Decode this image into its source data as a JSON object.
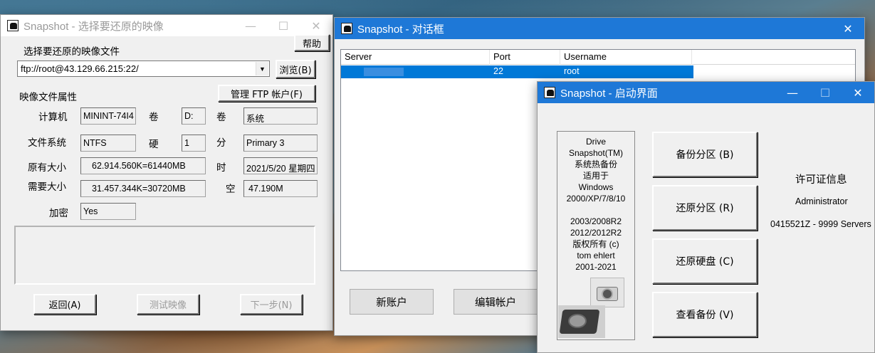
{
  "window1": {
    "title": "Snapshot - 选择要还原的映像",
    "help_button": "帮助",
    "image_file_label": "选择要还原的映像文件",
    "image_file_value": "ftp://root@43.129.66.215:22/",
    "browse_button": "浏览(B)",
    "properties_label": "映像文件属性",
    "manage_ftp_button": "管理 FTP 帐户(F)",
    "computer_label": "计算机",
    "computer_value": "MININT-74I4",
    "volume_label": "卷",
    "volume_value": "D:",
    "volume2_label": "卷",
    "volume2_value": "系统",
    "filesystem_label": "文件系统",
    "filesystem_value": "NTFS",
    "disk_label": "硬",
    "disk_value": "1",
    "partition_label": "分",
    "partition_value": "Primary 3",
    "orig_size_label": "原有大小",
    "orig_size_value": "62.914.560K=61440MB",
    "time_label": "时",
    "time_value": "2021/5/20 星期四",
    "need_size_label": "需要大小",
    "need_size_value": "31.457.344K=30720MB",
    "free_label": "空",
    "free_value": "47.190M",
    "encrypt_label": "加密",
    "encrypt_value": "Yes",
    "back_button": "返回(A)",
    "test_button": "测试映像",
    "next_button": "下一步(N)"
  },
  "window2": {
    "title": "Snapshot - 对话框",
    "columns": [
      "Server",
      "Port",
      "Username"
    ],
    "row": {
      "server": "",
      "port": "22",
      "username": "root"
    },
    "new_account_button": "新账户",
    "edit_account_button": "编辑帐户"
  },
  "window3": {
    "title": "Snapshot - 启动界面",
    "info_lines": [
      "Drive",
      "Snapshot(TM)",
      "系统热备份",
      "适用于",
      "Windows",
      "2000/XP/7/8/10",
      "",
      "2003/2008R2",
      "2012/2012R2",
      "版权所有 (c)",
      "tom ehlert",
      "2001-2021"
    ],
    "backup_button": "备份分区 (B)",
    "restore_partition_button": "还原分区 (R)",
    "restore_disk_button": "还原硬盘 (C)",
    "view_backup_button": "查看备份 (V)",
    "license_title": "许可证信息",
    "license_user": "Administrator",
    "license_key": "0415521Z - 9999 Servers"
  },
  "titlebar_icons": {
    "minimize": "minimize-icon",
    "maximize": "maximize-icon",
    "close": "close-icon"
  },
  "colors": {
    "active_title": "#1e78d7",
    "selection": "#0078d7"
  }
}
